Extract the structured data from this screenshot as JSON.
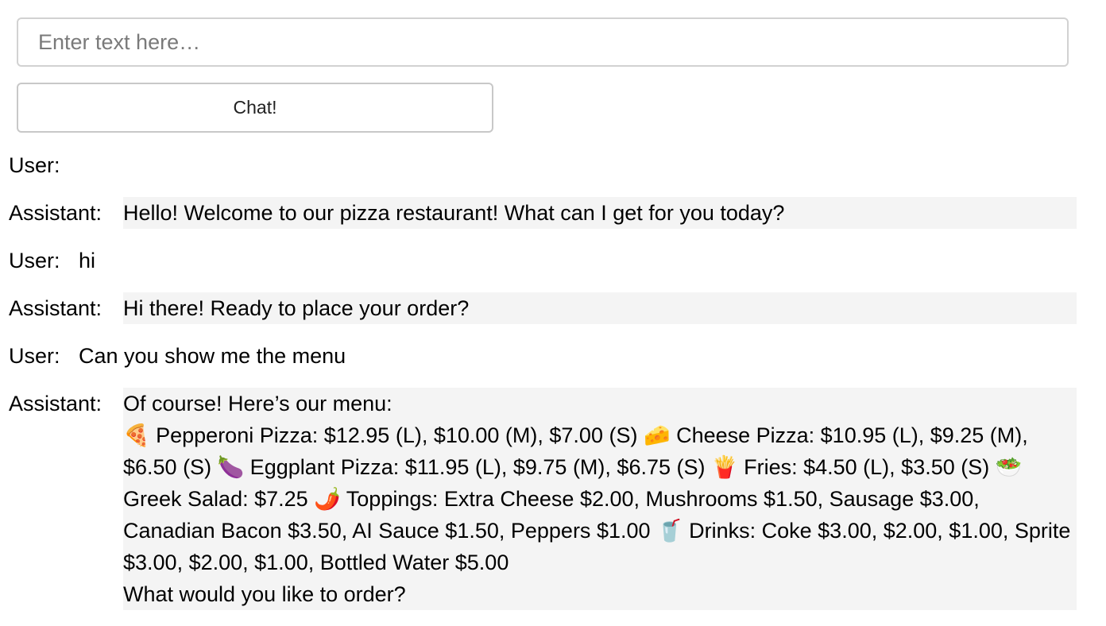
{
  "input": {
    "placeholder": "Enter text here…",
    "value": ""
  },
  "chat_button": {
    "label": "Chat!"
  },
  "messages": [
    {
      "role_label": "User:",
      "text": ""
    },
    {
      "role_label": "Assistant:",
      "text": "Hello! Welcome to our pizza restaurant! What can I get for you today?"
    },
    {
      "role_label": "User:",
      "text": "hi"
    },
    {
      "role_label": "Assistant:",
      "text": "Hi there! Ready to place your order?"
    },
    {
      "role_label": "User:",
      "text": "Can you show me the menu"
    },
    {
      "role_label": "Assistant:",
      "text": "Of course! Here’s our menu:\n🍕 Pepperoni Pizza: $12.95 (L), $10.00 (M), $7.00 (S) 🧀 Cheese Pizza: $10.95 (L), $9.25 (M), $6.50 (S) 🍆 Eggplant Pizza: $11.95 (L), $9.75 (M), $6.75 (S) 🍟 Fries: $4.50 (L), $3.50 (S) 🥗 Greek Salad: $7.25 🌶️ Toppings: Extra Cheese $2.00, Mushrooms $1.50, Sausage $3.00, Canadian Bacon $3.50, AI Sauce $1.50, Peppers $1.00 🥤 Drinks: Coke $3.00, $2.00, $1.00, Sprite $3.00, $2.00, $1.00, Bottled Water $5.00\nWhat would you like to order?"
    }
  ]
}
